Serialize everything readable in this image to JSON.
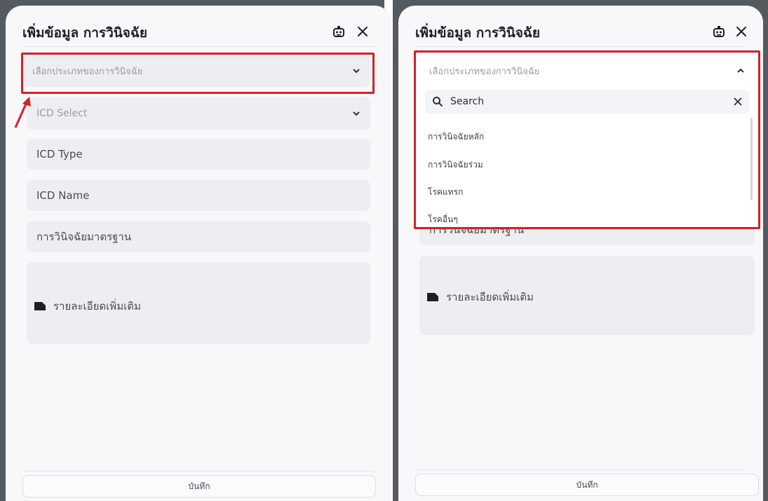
{
  "dialog": {
    "title": "เพิ่มข้อมูล การวินิจฉัย",
    "robot_icon": "robot-icon",
    "close_icon": "close-icon"
  },
  "form": {
    "diagnosis_type_placeholder": "เลือกประเภทของการวินิจฉัย",
    "icd_select_placeholder": "ICD Select",
    "icd_type": "ICD Type",
    "icd_name": "ICD Name",
    "standard_diagnosis": "การวินิจฉัยมาตรฐาน",
    "more_details": "รายละเอียดเพิ่มเติม",
    "save_label": "บันทึก"
  },
  "dropdown": {
    "search_placeholder": "Search",
    "options": [
      "การวินิจฉัยหลัก",
      "การวินิจฉัยร่วม",
      "โรคแทรก",
      "โรคอื่นๆ"
    ]
  },
  "colors": {
    "highlight": "#d61f26",
    "field_bg": "#eceef1",
    "panel_bg": "#f8f8fb",
    "backdrop": "#555a60"
  }
}
